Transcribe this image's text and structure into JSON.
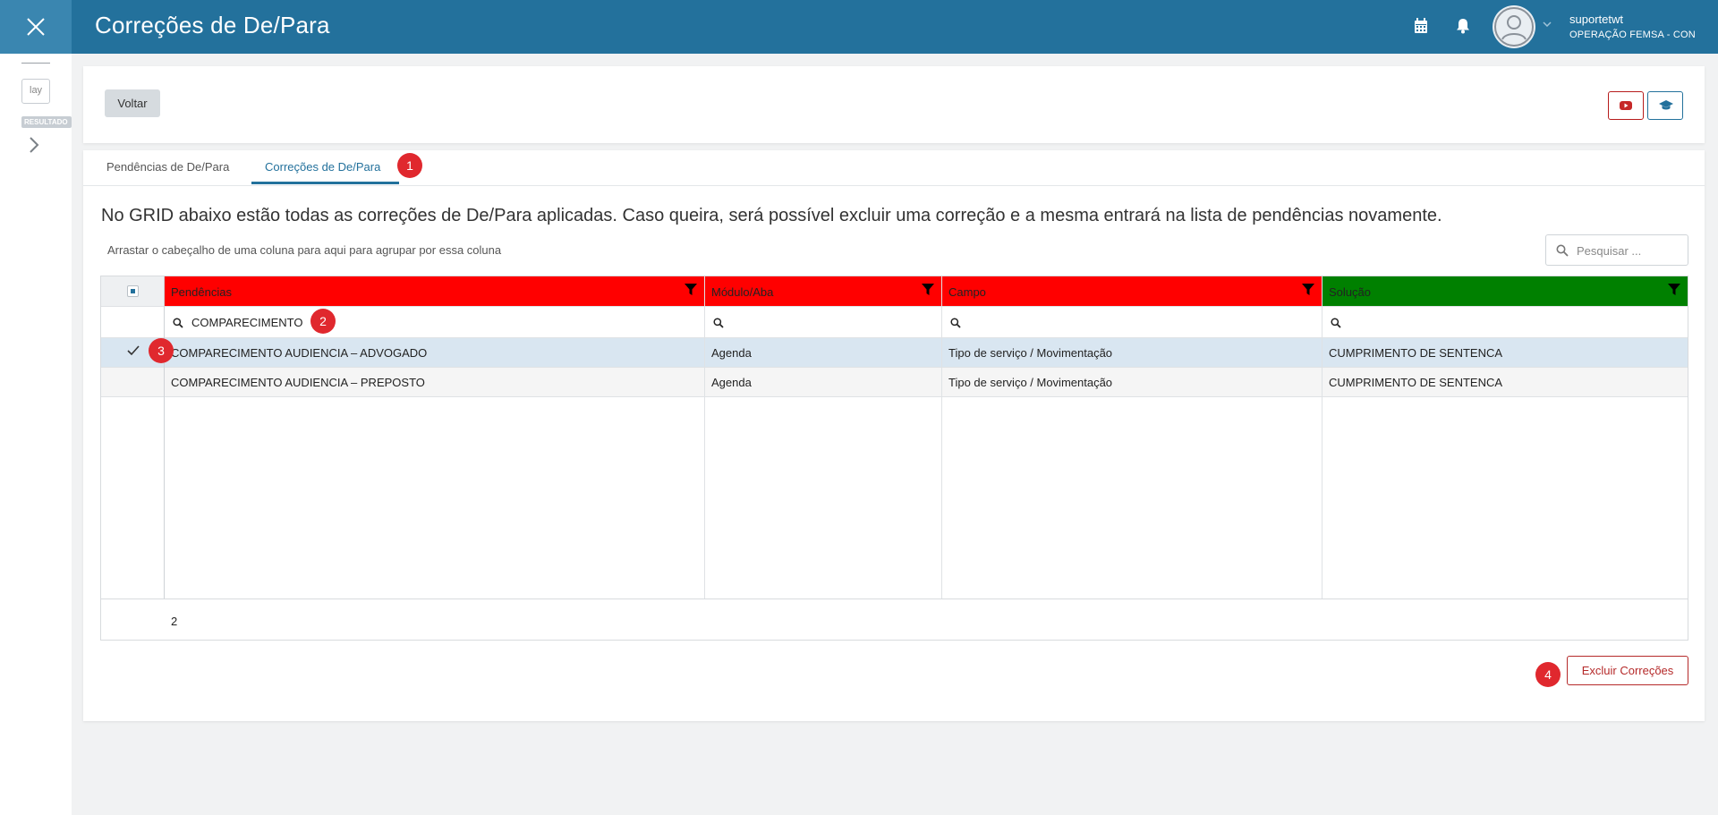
{
  "header": {
    "title": "Correções de De/Para",
    "user_name": "suportetwt",
    "user_org": "OPERAÇÃO FEMSA - CON"
  },
  "sidebar": {
    "input_value": "lay",
    "badge": "RESULTADO"
  },
  "toolbar": {
    "back_label": "Voltar"
  },
  "tabs": [
    {
      "label": "Pendências de De/Para",
      "active": false
    },
    {
      "label": "Correções de De/Para",
      "active": true
    }
  ],
  "main": {
    "description": "No GRID abaixo estão todas as correções de De/Para aplicadas. Caso queira, será possível excluir uma correção e a mesma entrará na lista de pendências novamente.",
    "group_hint": "Arrastar o cabeçalho de uma coluna para aqui para agrupar por essa coluna",
    "search_placeholder": "Pesquisar ..."
  },
  "grid": {
    "columns": [
      {
        "label": "Pendências",
        "header_color": "#ff0000"
      },
      {
        "label": "Módulo/Aba",
        "header_color": "#ff0000"
      },
      {
        "label": "Campo",
        "header_color": "#ff0000"
      },
      {
        "label": "Solução",
        "header_color": "#008000"
      }
    ],
    "filters": [
      "COMPARECIMENTO",
      "",
      "",
      ""
    ],
    "rows": [
      {
        "selected": true,
        "cells": [
          "COMPARECIMENTO AUDIENCIA – ADVOGADO",
          "Agenda",
          "Tipo de serviço / Movimentação",
          "CUMPRIMENTO DE SENTENCA"
        ]
      },
      {
        "selected": false,
        "cells": [
          "COMPARECIMENTO AUDIENCIA – PREPOSTO",
          "Agenda",
          "Tipo de serviço / Movimentação",
          "CUMPRIMENTO DE SENTENCA"
        ]
      }
    ],
    "total_count": "2"
  },
  "actions": {
    "delete_label": "Excluir Correções"
  },
  "markers": [
    "1",
    "2",
    "3",
    "4"
  ],
  "colors": {
    "header_bg": "#23719c",
    "accent": "#23719c",
    "danger": "#b52a2a",
    "marker": "#e0282e"
  },
  "icons": [
    "close-icon",
    "calendar-icon",
    "bell-icon",
    "user-avatar-icon",
    "chevron-down-icon",
    "chevron-right-icon",
    "youtube-icon",
    "graduation-cap-icon",
    "search-icon",
    "filter-icon",
    "check-icon"
  ]
}
